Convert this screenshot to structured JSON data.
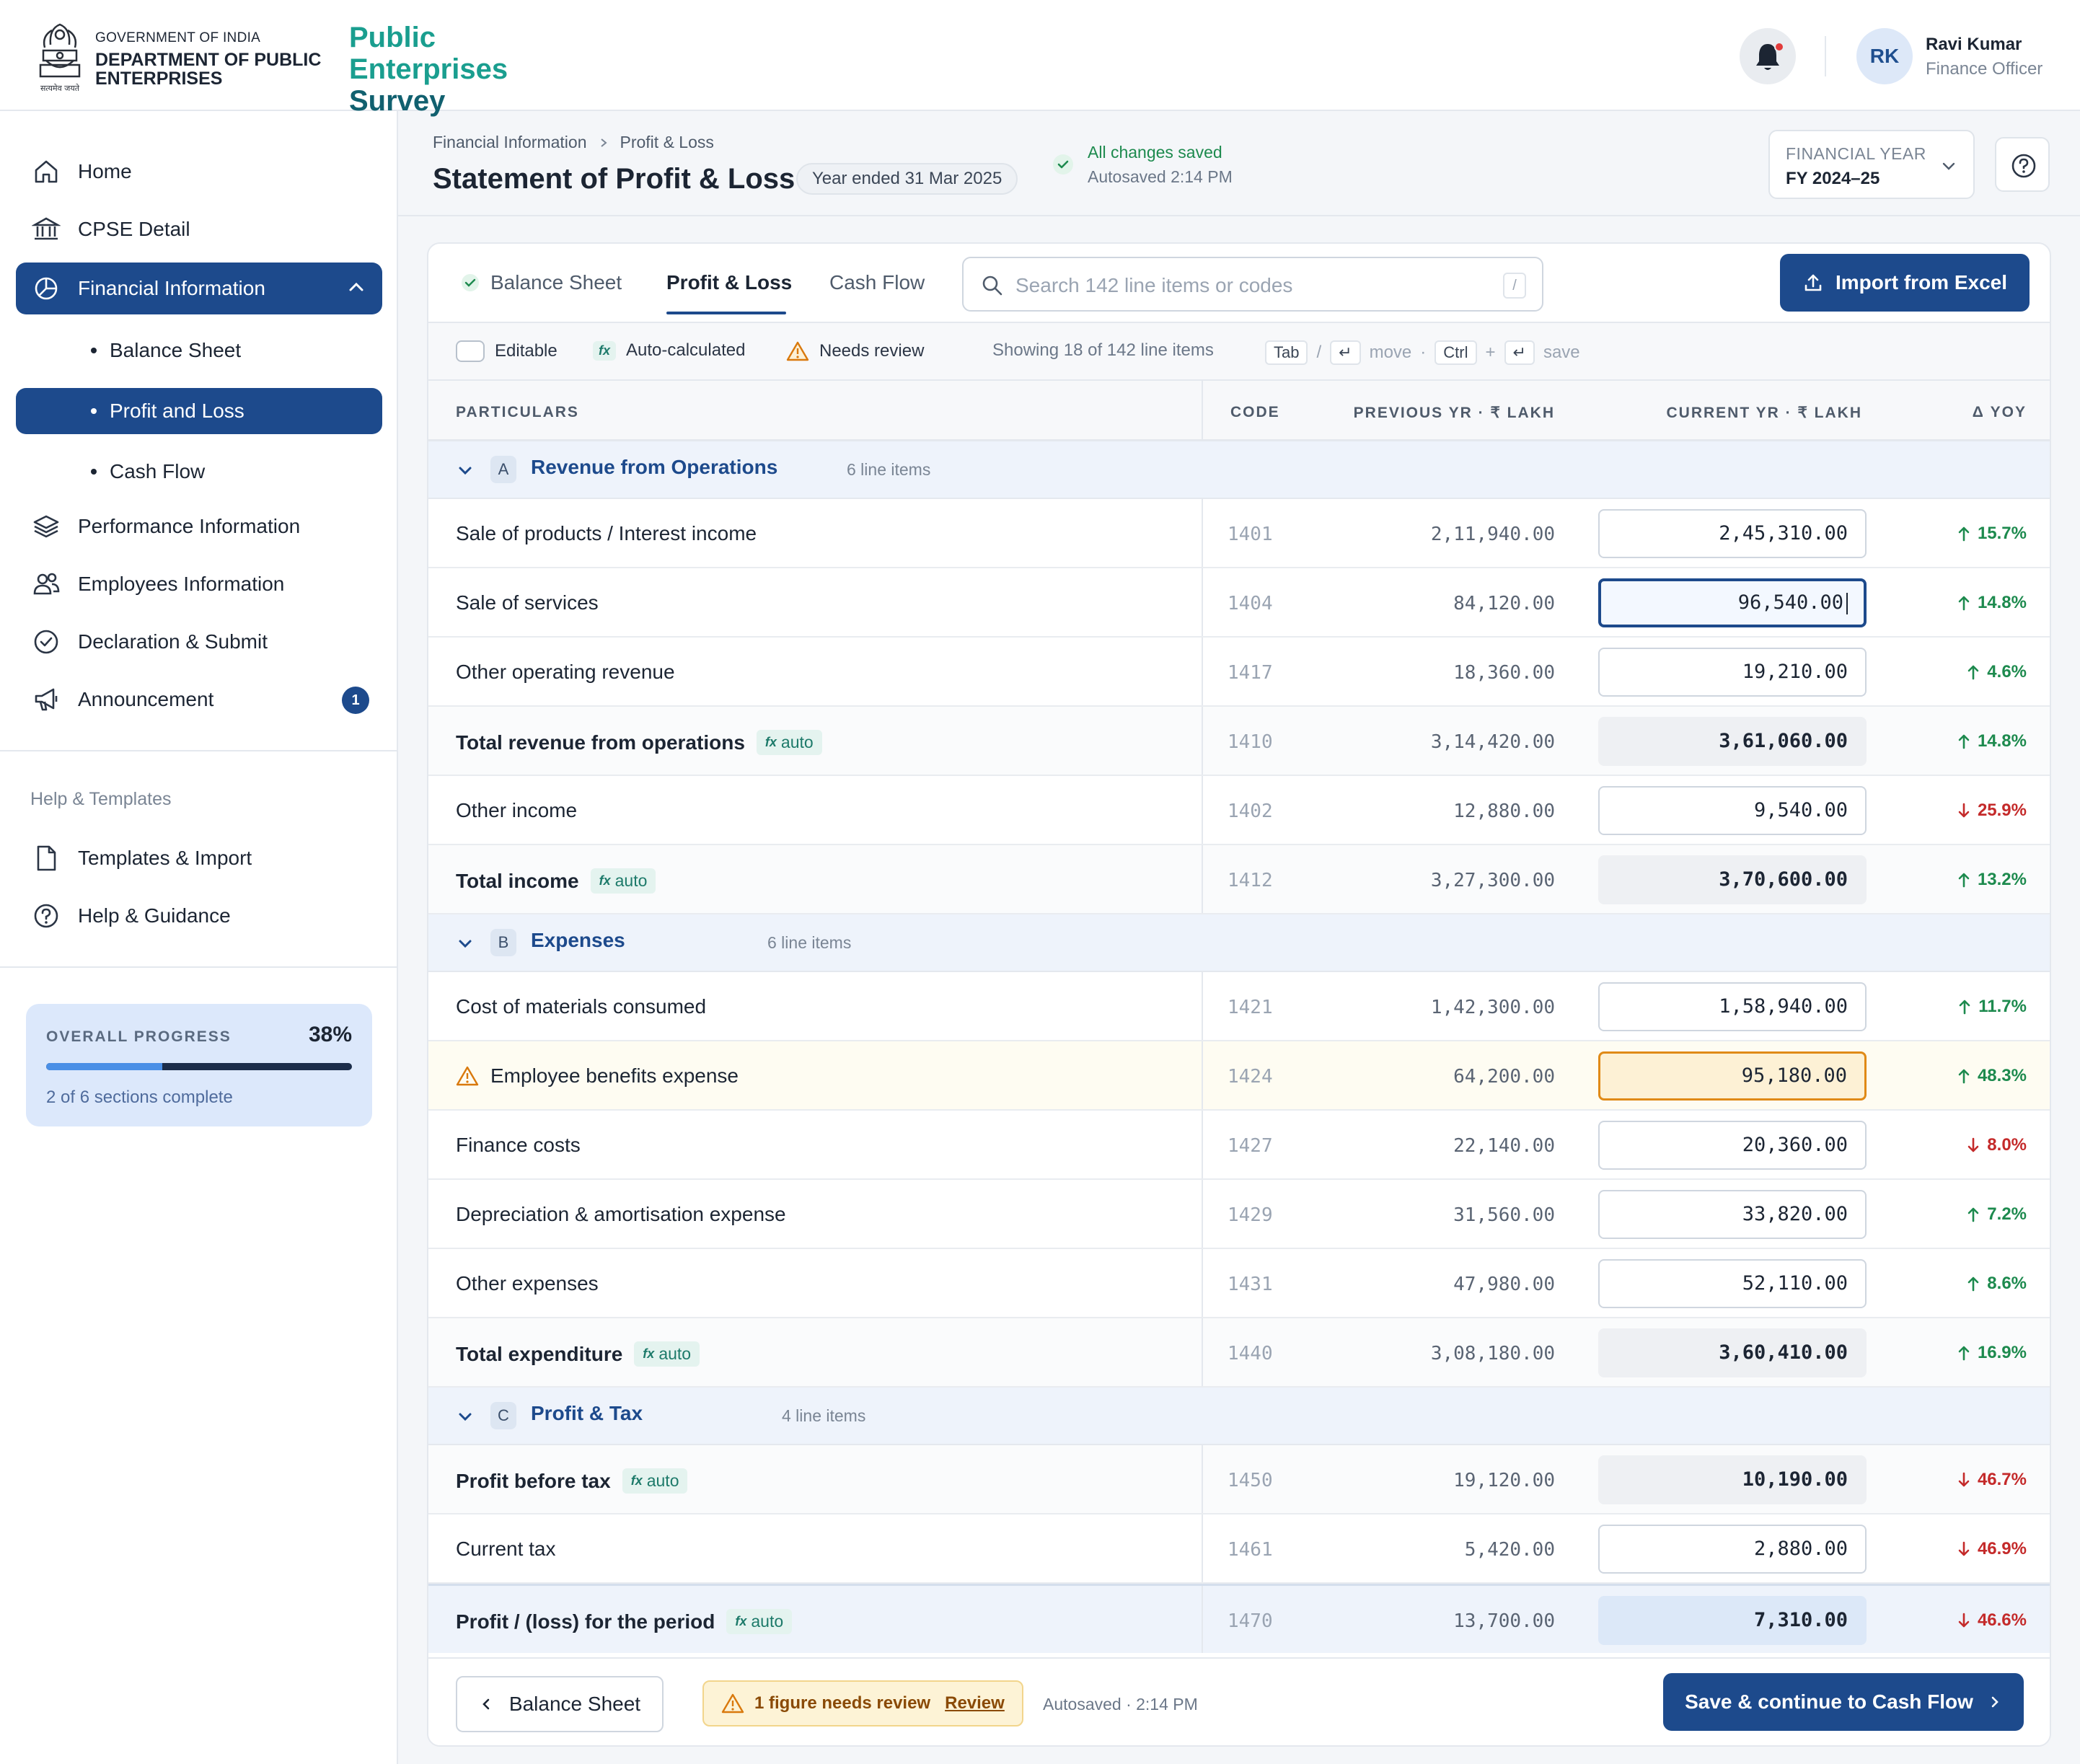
{
  "header": {
    "gov_label": "GOVERNMENT OF INDIA",
    "dept_name": "DEPARTMENT OF PUBLIC ENTERPRISES",
    "emblem_motto": "सत्यमेव जयते",
    "app_title_1": "Public Enterprises",
    "app_title_2": "Survey",
    "user_initials": "RK",
    "user_name": "Ravi Kumar",
    "user_role": "Finance Officer"
  },
  "sidebar": {
    "items": [
      {
        "label": "Home",
        "icon": "home-icon"
      },
      {
        "label": "CPSE Detail",
        "icon": "bank-icon"
      },
      {
        "label": "Financial Information",
        "icon": "pie-chart-icon"
      },
      {
        "label": "Performance Information",
        "icon": "layers-icon"
      },
      {
        "label": "Employees Information",
        "icon": "users-icon"
      },
      {
        "label": "Declaration & Submit",
        "icon": "check-circle-icon"
      },
      {
        "label": "Announcement",
        "icon": "megaphone-icon",
        "badge": "1"
      }
    ],
    "subitems": [
      "Balance Sheet",
      "Profit and Loss",
      "Cash Flow"
    ],
    "help_heading": "Help & Templates",
    "help_items": [
      {
        "label": "Templates & Import",
        "icon": "file-icon"
      },
      {
        "label": "Help & Guidance",
        "icon": "help-circle-icon"
      }
    ],
    "progress": {
      "label": "OVERALL PROGRESS",
      "percent_text": "38%",
      "fraction": 0.38,
      "sub": "2 of 6 sections complete"
    }
  },
  "page": {
    "breadcrumb": [
      "Financial Information",
      "Profit & Loss"
    ],
    "title": "Statement of Profit & Loss",
    "year_pill": "Year ended 31 Mar 2025",
    "saved": "All changes saved",
    "autosaved": "Autosaved 2:14 PM",
    "fy_label": "FINANCIAL YEAR",
    "fy_value": "FY 2024–25"
  },
  "tabs": [
    "Balance Sheet",
    "Profit & Loss",
    "Cash Flow"
  ],
  "search": {
    "placeholder": "Search 142 line items or codes",
    "shortcut": "/"
  },
  "import_label": "Import from Excel",
  "legend": {
    "editable": "Editable",
    "auto_chip": "fx",
    "auto": "Auto-calculated",
    "review": "Needs review",
    "showing": "Showing 18 of 142 line items",
    "key_tab": "Tab",
    "slash": "/",
    "key_enter": "↵",
    "move": "move",
    "dot": "·",
    "key_ctrl": "Ctrl",
    "plus": "+",
    "save": "save"
  },
  "table": {
    "headers": [
      "PARTICULARS",
      "CODE",
      "PREVIOUS YR · ₹ LAKH",
      "CURRENT YR · ₹ LAKH",
      "Δ YOY"
    ],
    "auto_label": "auto",
    "auto_fx": "fx",
    "sections": [
      {
        "letter": "A",
        "name": "Revenue from Operations",
        "count": "6 line items"
      },
      {
        "letter": "B",
        "name": "Expenses",
        "count": "6 line items"
      },
      {
        "letter": "C",
        "name": "Profit & Tax",
        "count": "4 line items"
      }
    ],
    "rows": [
      {
        "label": "Sale of products / Interest income",
        "code": "1401",
        "prev": "2,11,940.00",
        "cur": "2,45,310.00",
        "yoy": "15.7%",
        "dir": "up"
      },
      {
        "label": "Sale of services",
        "code": "1404",
        "prev": "84,120.00",
        "cur": "96,540.00",
        "yoy": "14.8%",
        "dir": "up"
      },
      {
        "label": "Other operating revenue",
        "code": "1417",
        "prev": "18,360.00",
        "cur": "19,210.00",
        "yoy": "4.6%",
        "dir": "up"
      },
      {
        "label": "Total revenue from operations",
        "code": "1410",
        "prev": "3,14,420.00",
        "cur": "3,61,060.00",
        "yoy": "14.8%",
        "dir": "up"
      },
      {
        "label": "Other income",
        "code": "1402",
        "prev": "12,880.00",
        "cur": "9,540.00",
        "yoy": "25.9%",
        "dir": "down"
      },
      {
        "label": "Total income",
        "code": "1412",
        "prev": "3,27,300.00",
        "cur": "3,70,600.00",
        "yoy": "13.2%",
        "dir": "up"
      },
      {
        "label": "Cost of materials consumed",
        "code": "1421",
        "prev": "1,42,300.00",
        "cur": "1,58,940.00",
        "yoy": "11.7%",
        "dir": "up"
      },
      {
        "label": "Employee benefits expense",
        "code": "1424",
        "prev": "64,200.00",
        "cur": "95,180.00",
        "yoy": "48.3%",
        "dir": "up"
      },
      {
        "label": "Finance costs",
        "code": "1427",
        "prev": "22,140.00",
        "cur": "20,360.00",
        "yoy": "8.0%",
        "dir": "down"
      },
      {
        "label": "Depreciation & amortisation expense",
        "code": "1429",
        "prev": "31,560.00",
        "cur": "33,820.00",
        "yoy": "7.2%",
        "dir": "up"
      },
      {
        "label": "Other expenses",
        "code": "1431",
        "prev": "47,980.00",
        "cur": "52,110.00",
        "yoy": "8.6%",
        "dir": "up"
      },
      {
        "label": "Total expenditure",
        "code": "1440",
        "prev": "3,08,180.00",
        "cur": "3,60,410.00",
        "yoy": "16.9%",
        "dir": "up"
      },
      {
        "label": "Profit before tax",
        "code": "1450",
        "prev": "19,120.00",
        "cur": "10,190.00",
        "yoy": "46.7%",
        "dir": "down"
      },
      {
        "label": "Current tax",
        "code": "1461",
        "prev": "5,420.00",
        "cur": "2,880.00",
        "yoy": "46.9%",
        "dir": "down"
      },
      {
        "label": "Profit / (loss) for the period",
        "code": "1470",
        "prev": "13,700.00",
        "cur": "7,310.00",
        "yoy": "46.6%",
        "dir": "down"
      }
    ]
  },
  "footer": {
    "back": "Balance Sheet",
    "review_text": "1 figure needs review",
    "review_link": "Review",
    "autosaved": "Autosaved · 2:14 PM",
    "save": "Save & continue to Cash Flow"
  },
  "colors": {
    "primary": "#1d4a8c",
    "teal": "#1a9e8f",
    "up": "#1d8a4e",
    "down": "#c42a2a",
    "warn": "#e08a17"
  }
}
